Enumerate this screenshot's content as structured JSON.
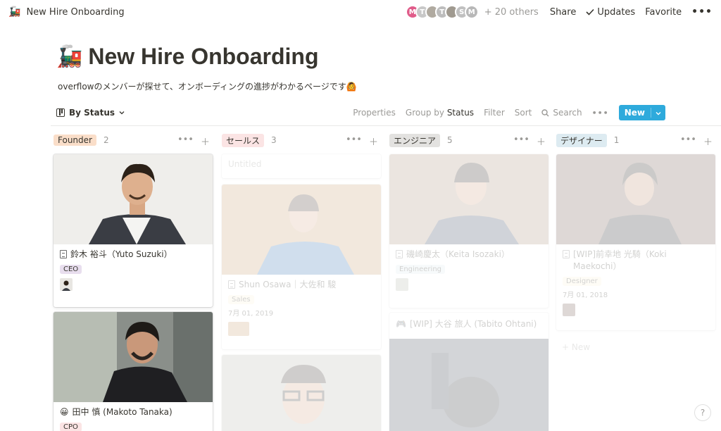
{
  "topbar": {
    "page_emoji": "🚂",
    "breadcrumb": "New Hire Onboarding",
    "avatars": [
      {
        "letter": "M",
        "color": "#e05c8a"
      },
      {
        "letter": "T",
        "color": "#c8c8c8"
      },
      {
        "letter": "",
        "color": "#b0aaa0"
      },
      {
        "letter": "T",
        "color": "#bdbdbd"
      },
      {
        "letter": "",
        "color": "#a09a90"
      },
      {
        "letter": "S",
        "color": "#c0c0c0"
      },
      {
        "letter": "M",
        "color": "#b8b8b8"
      }
    ],
    "others": "+ 20 others",
    "share": "Share",
    "updates": "Updates",
    "favorite": "Favorite",
    "more": "•••"
  },
  "page": {
    "emoji": "🚂",
    "title": "New Hire Onboarding",
    "description": "overflowのメンバーが探せて、オンボーディングの進捗がわかるページです🙆"
  },
  "viewbar": {
    "view_name": "By Status",
    "properties": "Properties",
    "group_by": "Group by",
    "group_by_value": "Status",
    "filter": "Filter",
    "sort": "Sort",
    "search": "Search",
    "more": "•••",
    "new": "New"
  },
  "columns": [
    {
      "name": "Founder",
      "count": "2",
      "color": "#fadec9",
      "cards": [
        {
          "title": "鈴木 裕斗（Yuto Suzuki）",
          "tag": "CEO",
          "tag_color": "#e8deee"
        },
        {
          "emoji": "😀",
          "title": "田中 慎 (Makoto Tanaka)",
          "tag": "CPO",
          "tag_color": "#fbe4e4"
        }
      ]
    },
    {
      "name": "セールス",
      "count": "3",
      "color": "#fbe4e4",
      "untitled": "Untitled",
      "cards": [
        {
          "title": "Shun Osawa｜大佐和 駿",
          "tag": "Sales",
          "tag_color": "#fbf3db",
          "date": "7月 01, 2019"
        }
      ]
    },
    {
      "name": "エンジニア",
      "count": "5",
      "color": "#e3e2e0",
      "cards": [
        {
          "title": "磯崎慶太（Keita Isozaki）",
          "tag": "Engineering",
          "tag_color": "#ddebf1"
        },
        {
          "emoji": "🎮",
          "title": "[WIP] 大谷 旅人 (Tabito Ohtani)"
        }
      ]
    },
    {
      "name": "デザイナー",
      "count": "1",
      "color": "#ddebf1",
      "new_row": "+ New",
      "cards": [
        {
          "title": "[WIP]前幸地 光騎（Koki Maekochi）",
          "tag": "Designer",
          "tag_color": "#fbf3db",
          "date": "7月 01, 2018"
        }
      ]
    }
  ],
  "help": "?"
}
